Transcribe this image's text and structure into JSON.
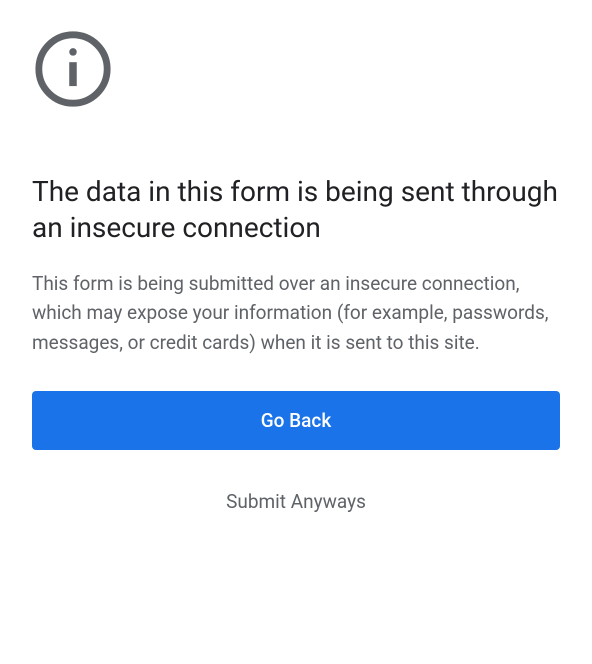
{
  "warning": {
    "heading": "The data in this form is being sent through an insecure connection",
    "description": "This form is being submitted over an insecure connection, which may expose your information (for example, passwords, messages, or credit cards) when it is sent to this site."
  },
  "buttons": {
    "primary_label": "Go Back",
    "secondary_label": "Submit Anyways"
  },
  "colors": {
    "primary": "#1a73e8",
    "text_heading": "#202124",
    "text_body": "#5f6368",
    "icon": "#5f6368"
  }
}
